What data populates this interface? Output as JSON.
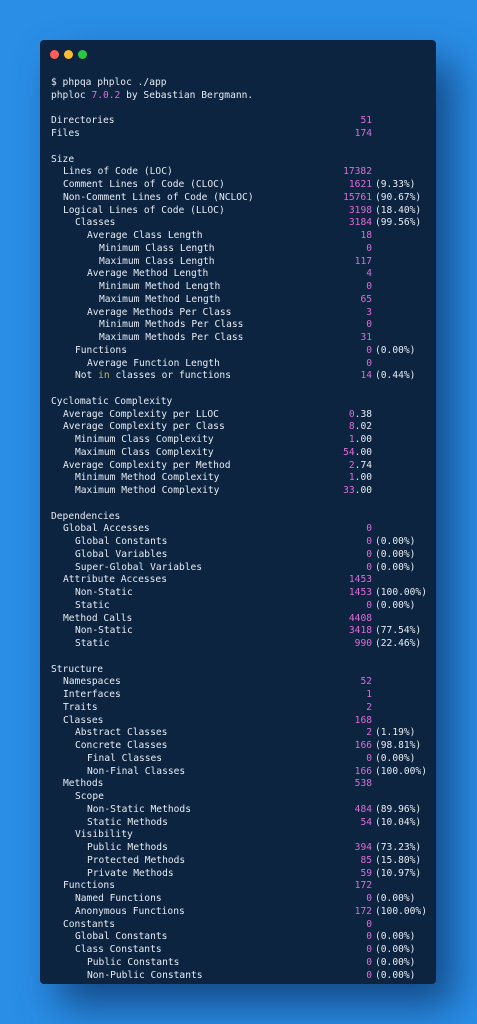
{
  "command": "$ phpqa phploc ./app",
  "header": {
    "prefix": "phploc ",
    "version": "7.0.2",
    "suffix": " by Sebastian Bergmann."
  },
  "blocks": [
    {
      "rows": [
        {
          "label": "Directories",
          "level": 0,
          "value": "51"
        },
        {
          "label": "Files",
          "level": 0,
          "value": "174"
        }
      ]
    },
    {
      "rows": [
        {
          "label": "Size",
          "level": 0
        },
        {
          "label": "Lines of Code (LOC)",
          "level": 1,
          "value": "17382"
        },
        {
          "label": "Comment Lines of Code (CLOC)",
          "level": 1,
          "value": "1621",
          "pct": "(9.33%)"
        },
        {
          "label": "Non-Comment Lines of Code (NCLOC)",
          "level": 1,
          "value": "15761",
          "pct": "(90.67%)"
        },
        {
          "label": "Logical Lines of Code (LLOC)",
          "level": 1,
          "value": "3198",
          "pct": "(18.40%)"
        },
        {
          "label": "Classes",
          "level": 2,
          "value": "3184",
          "pct": "(99.56%)"
        },
        {
          "label": "Average Class Length",
          "level": 3,
          "value": "18"
        },
        {
          "label": "Minimum Class Length",
          "level": 4,
          "value": "0"
        },
        {
          "label": "Maximum Class Length",
          "level": 4,
          "value": "117"
        },
        {
          "label": "Average Method Length",
          "level": 3,
          "value": "4"
        },
        {
          "label": "Minimum Method Length",
          "level": 4,
          "value": "0"
        },
        {
          "label": "Maximum Method Length",
          "level": 4,
          "value": "65"
        },
        {
          "label": "Average Methods Per Class",
          "level": 3,
          "value": "3"
        },
        {
          "label": "Minimum Methods Per Class",
          "level": 4,
          "value": "0"
        },
        {
          "label": "Maximum Methods Per Class",
          "level": 4,
          "value": "31"
        },
        {
          "label": "Functions",
          "level": 2,
          "value": "0",
          "pct": "(0.00%)"
        },
        {
          "label": "Average Function Length",
          "level": 3,
          "value": "0"
        },
        {
          "label_pre": "Not ",
          "label_kw": "in",
          "label_post": " classes or functions",
          "level": 2,
          "value": "14",
          "pct": "(0.44%)"
        }
      ]
    },
    {
      "rows": [
        {
          "label": "Cyclomatic Complexity",
          "level": 0
        },
        {
          "label": "Average Complexity per LLOC",
          "level": 1,
          "value_int": "0",
          "value_dec": ".38"
        },
        {
          "label": "Average Complexity per Class",
          "level": 1,
          "value_int": "8",
          "value_dec": ".02"
        },
        {
          "label": "Minimum Class Complexity",
          "level": 2,
          "value_int": "1",
          "value_dec": ".00"
        },
        {
          "label": "Maximum Class Complexity",
          "level": 2,
          "value_int": "54",
          "value_dec": ".00"
        },
        {
          "label": "Average Complexity per Method",
          "level": 1,
          "value_int": "2",
          "value_dec": ".74"
        },
        {
          "label": "Minimum Method Complexity",
          "level": 2,
          "value_int": "1",
          "value_dec": ".00"
        },
        {
          "label": "Maximum Method Complexity",
          "level": 2,
          "value_int": "33",
          "value_dec": ".00"
        }
      ]
    },
    {
      "rows": [
        {
          "label": "Dependencies",
          "level": 0
        },
        {
          "label": "Global Accesses",
          "level": 1,
          "value": "0"
        },
        {
          "label": "Global Constants",
          "level": 2,
          "value": "0",
          "pct": "(0.00%)"
        },
        {
          "label": "Global Variables",
          "level": 2,
          "value": "0",
          "pct": "(0.00%)"
        },
        {
          "label": "Super-Global Variables",
          "level": 2,
          "value": "0",
          "pct": "(0.00%)"
        },
        {
          "label": "Attribute Accesses",
          "level": 1,
          "value": "1453"
        },
        {
          "label": "Non-Static",
          "level": 2,
          "value": "1453",
          "pct": "(100.00%)"
        },
        {
          "label": "Static",
          "level": 2,
          "value": "0",
          "pct": "(0.00%)"
        },
        {
          "label": "Method Calls",
          "level": 1,
          "value": "4408"
        },
        {
          "label": "Non-Static",
          "level": 2,
          "value": "3418",
          "pct": "(77.54%)"
        },
        {
          "label": "Static",
          "level": 2,
          "value": "990",
          "pct": "(22.46%)"
        }
      ]
    },
    {
      "rows": [
        {
          "label": "Structure",
          "level": 0
        },
        {
          "label": "Namespaces",
          "level": 1,
          "value": "52"
        },
        {
          "label": "Interfaces",
          "level": 1,
          "value": "1"
        },
        {
          "label": "Traits",
          "level": 1,
          "value": "2"
        },
        {
          "label": "Classes",
          "level": 1,
          "value": "168"
        },
        {
          "label": "Abstract Classes",
          "level": 2,
          "value": "2",
          "pct": "(1.19%)"
        },
        {
          "label": "Concrete Classes",
          "level": 2,
          "value": "166",
          "pct": "(98.81%)"
        },
        {
          "label": "Final Classes",
          "level": 3,
          "value": "0",
          "pct": "(0.00%)"
        },
        {
          "label": "Non-Final Classes",
          "level": 3,
          "value": "166",
          "pct": "(100.00%)"
        },
        {
          "label": "Methods",
          "level": 1,
          "value": "538"
        },
        {
          "label": "Scope",
          "level": 2
        },
        {
          "label": "Non-Static Methods",
          "level": 3,
          "value": "484",
          "pct": "(89.96%)"
        },
        {
          "label": "Static Methods",
          "level": 3,
          "value": "54",
          "pct": "(10.04%)"
        },
        {
          "label": "Visibility",
          "level": 2
        },
        {
          "label": "Public Methods",
          "level": 3,
          "value": "394",
          "pct": "(73.23%)"
        },
        {
          "label": "Protected Methods",
          "level": 3,
          "value": "85",
          "pct": "(15.80%)"
        },
        {
          "label": "Private Methods",
          "level": 3,
          "value": "59",
          "pct": "(10.97%)"
        },
        {
          "label": "Functions",
          "level": 1,
          "value": "172"
        },
        {
          "label": "Named Functions",
          "level": 2,
          "value": "0",
          "pct": "(0.00%)"
        },
        {
          "label": "Anonymous Functions",
          "level": 2,
          "value": "172",
          "pct": "(100.00%)"
        },
        {
          "label": "Constants",
          "level": 1,
          "value": "0"
        },
        {
          "label": "Global Constants",
          "level": 2,
          "value": "0",
          "pct": "(0.00%)"
        },
        {
          "label": "Class Constants",
          "level": 2,
          "value": "0",
          "pct": "(0.00%)"
        },
        {
          "label": "Public Constants",
          "level": 3,
          "value": "0",
          "pct": "(0.00%)"
        },
        {
          "label": "Non-Public Constants",
          "level": 3,
          "value": "0",
          "pct": "(0.00%)"
        }
      ]
    }
  ]
}
